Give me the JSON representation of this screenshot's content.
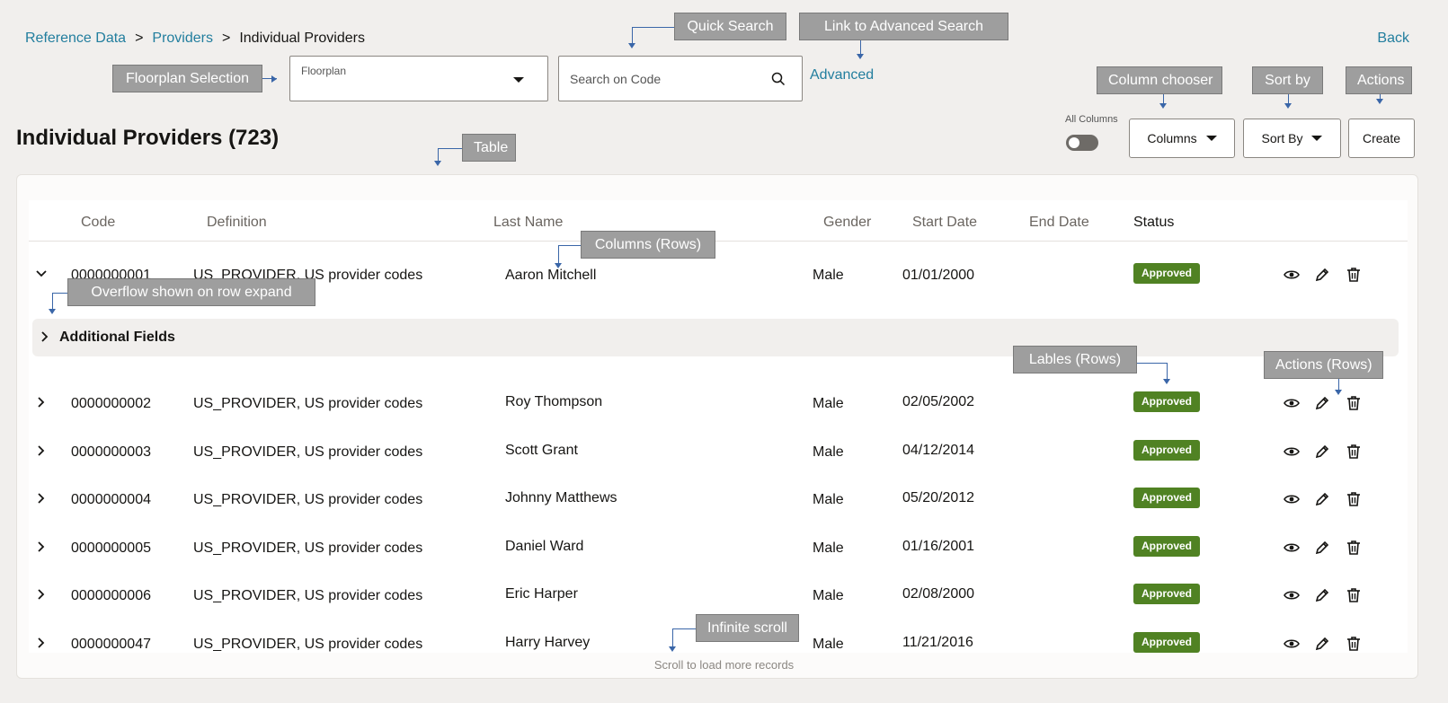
{
  "breadcrumb": {
    "items": [
      "Reference Data",
      "Providers"
    ],
    "separator": ">",
    "current": "Individual Providers"
  },
  "back_label": "Back",
  "floorplan": {
    "label": "Floorplan"
  },
  "search": {
    "placeholder": "Search on Code"
  },
  "advanced_label": "Advanced",
  "page_title": "Individual Providers (723)",
  "toolbar": {
    "all_columns_label": "All Columns",
    "all_columns_on": false,
    "columns_label": "Columns",
    "sort_by_label": "Sort By",
    "create_label": "Create"
  },
  "table": {
    "columns": {
      "code": "Code",
      "definition": "Definition",
      "last_name": "Last Name",
      "gender": "Gender",
      "start_date": "Start Date",
      "end_date": "End Date",
      "status": "Status"
    },
    "additional_fields_label": "Additional Fields",
    "rows": [
      {
        "code": "0000000001",
        "definition": "US_PROVIDER, US provider codes",
        "last_name": "Aaron Mitchell",
        "gender": "Male",
        "start_date": "01/01/2000",
        "end_date": "",
        "status": "Approved",
        "expanded": true
      },
      {
        "code": "0000000002",
        "definition": "US_PROVIDER, US provider codes",
        "last_name": "Roy Thompson",
        "gender": "Male",
        "start_date": "02/05/2002",
        "end_date": "",
        "status": "Approved",
        "expanded": false
      },
      {
        "code": "0000000003",
        "definition": "US_PROVIDER, US provider codes",
        "last_name": "Scott Grant",
        "gender": "Male",
        "start_date": "04/12/2014",
        "end_date": "",
        "status": "Approved",
        "expanded": false
      },
      {
        "code": "0000000004",
        "definition": "US_PROVIDER, US provider codes",
        "last_name": "Johnny Matthews",
        "gender": "Male",
        "start_date": "05/20/2012",
        "end_date": "",
        "status": "Approved",
        "expanded": false
      },
      {
        "code": "0000000005",
        "definition": "US_PROVIDER, US provider codes",
        "last_name": "Daniel Ward",
        "gender": "Male",
        "start_date": "01/16/2001",
        "end_date": "",
        "status": "Approved",
        "expanded": false
      },
      {
        "code": "0000000006",
        "definition": "US_PROVIDER, US provider codes",
        "last_name": "Eric Harper",
        "gender": "Male",
        "start_date": "02/08/2000",
        "end_date": "",
        "status": "Approved",
        "expanded": false
      },
      {
        "code": "0000000047",
        "definition": "US_PROVIDER, US provider codes",
        "last_name": "Harry Harvey",
        "gender": "Male",
        "start_date": "11/21/2016",
        "end_date": "",
        "status": "Approved",
        "expanded": false
      }
    ],
    "scroll_message": "Scroll to load more records"
  },
  "annotations": {
    "floorplan_selection": "Floorplan Selection",
    "quick_search": "Quick Search",
    "link_advanced": "Link to Advanced Search",
    "column_chooser": "Column chooser",
    "sort_by": "Sort by",
    "actions": "Actions",
    "table": "Table",
    "columns_rows": "Columns (Rows)",
    "overflow": "Overflow shown on row expand",
    "labels_rows": "Lables (Rows)",
    "actions_rows": "Actions (Rows)",
    "infinite_scroll": "Infinite scroll"
  },
  "colors": {
    "link": "#227e9e",
    "badge_approved": "#508223",
    "callout_bg": "#9e9e9e",
    "leader": "#3a66a8",
    "page_bg": "#f1efed"
  },
  "icons": {
    "search": "search-icon",
    "view": "eye-icon",
    "edit": "pencil-icon",
    "delete": "trash-icon",
    "expand": "chevron-right-icon",
    "collapse": "chevron-down-icon"
  }
}
